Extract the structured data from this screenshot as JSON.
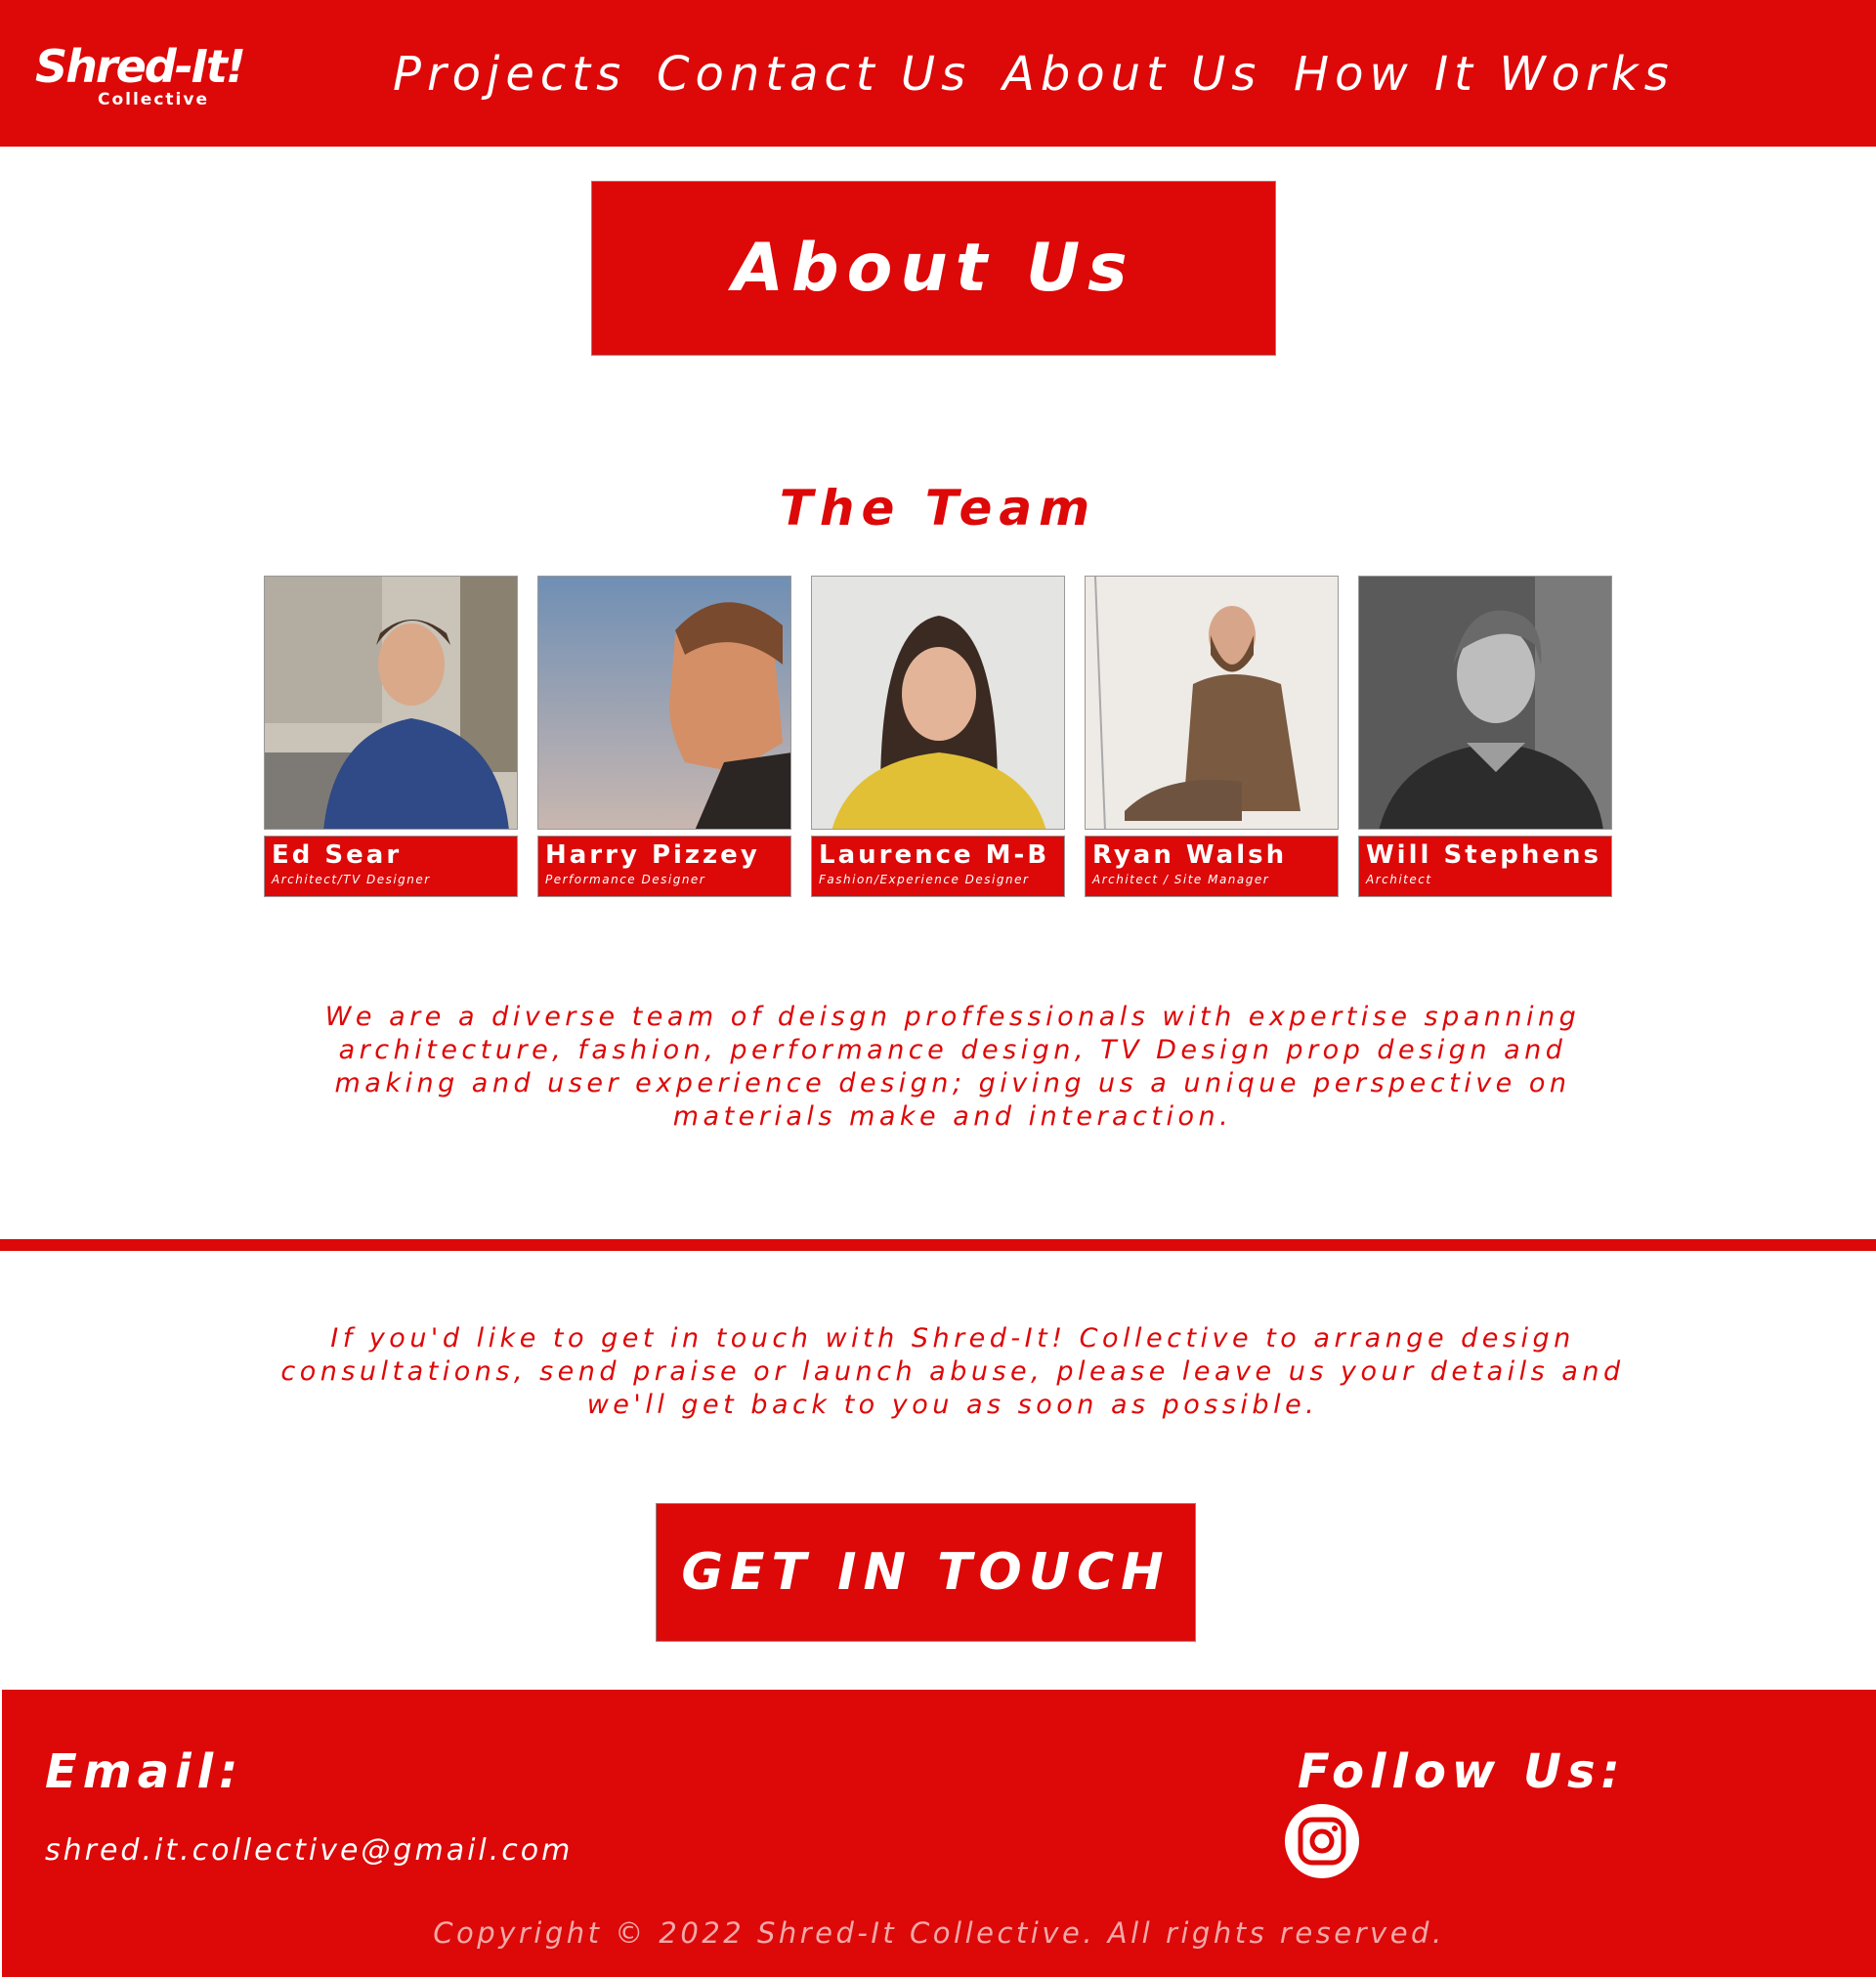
{
  "brand": {
    "name": "Shred-It!",
    "subtitle": "Collective"
  },
  "nav": {
    "items": [
      {
        "label": "Projects"
      },
      {
        "label": "Contact Us"
      },
      {
        "label": "About Us"
      },
      {
        "label": "How It Works"
      }
    ]
  },
  "about": {
    "title": "About Us"
  },
  "team": {
    "title": "The Team",
    "members": [
      {
        "name": "Ed Sear",
        "role": "Architect/TV Designer"
      },
      {
        "name": "Harry Pizzey",
        "role": "Performance Designer"
      },
      {
        "name": "Laurence M-B",
        "role": "Fashion/Experience Designer"
      },
      {
        "name": "Ryan Walsh",
        "role": "Architect / Site Manager"
      },
      {
        "name": "Will Stephens",
        "role": "Architect"
      }
    ],
    "description": "We are a diverse team of deisgn proffessionals with expertise spanning architecture, fashion, performance design, TV Design prop design and making and user experience design;  giving us a unique perspective on materials make and interaction."
  },
  "contact": {
    "text": "If you'd like to get in touch with Shred-It! Collective to arrange design consultations, send praise or launch abuse, please leave us your details and we'll get back to you as soon as possible.",
    "cta_label": "GET IN TOUCH"
  },
  "footer": {
    "email_heading": "Email:",
    "email": "shred.it.collective@gmail.com",
    "follow_heading": "Follow Us:",
    "social_icon": "instagram-icon",
    "copyright": "Copyright © 2022 Shred-It Collective. All rights reserved."
  },
  "colors": {
    "brand_red": "#dd0808",
    "white": "#ffffff",
    "copyright_text": "#f1a9a9"
  }
}
